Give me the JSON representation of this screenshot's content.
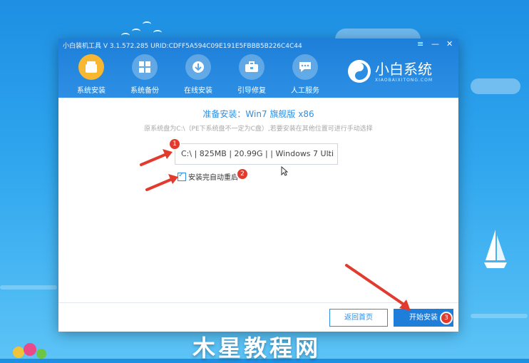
{
  "window": {
    "title": "小白装机工具 V 3.1.572.285 URID:CDFF5A594C09E191E5FBBB5B226C4C44",
    "controls": [
      "≡",
      "—",
      "✕"
    ]
  },
  "nav": {
    "items": [
      {
        "label": "系统安装",
        "icon": "box-icon"
      },
      {
        "label": "系统备份",
        "icon": "windows-icon"
      },
      {
        "label": "在线安装",
        "icon": "download-icon"
      },
      {
        "label": "引导修复",
        "icon": "toolkit-icon"
      },
      {
        "label": "人工服务",
        "icon": "chat-icon"
      }
    ],
    "active_index": 0
  },
  "brand": {
    "name": "小白系统",
    "sub": "XIAOBAIXITONG.COM"
  },
  "main": {
    "headline": "准备安装：Win7 旗舰版 x86",
    "subline": "原系统盘为C:\\（PE下系统盘不一定为C盘）,若要安装在其他位置可进行手动选择",
    "disk_select": "C:\\ | 825MB | 20.99G |  | Windows 7 Ulti",
    "checkbox_label": "安装完自动重启",
    "checkbox_checked": true
  },
  "footer": {
    "home_button": "返回首页",
    "start_button": "开始安装"
  },
  "annotations": {
    "badge1": "1",
    "badge2": "2",
    "badge3": "3"
  },
  "watermark": "木星教程网",
  "colors": {
    "accent": "#2d8fe4",
    "active_nav": "#f7b731",
    "badge": "#e23b2e"
  }
}
